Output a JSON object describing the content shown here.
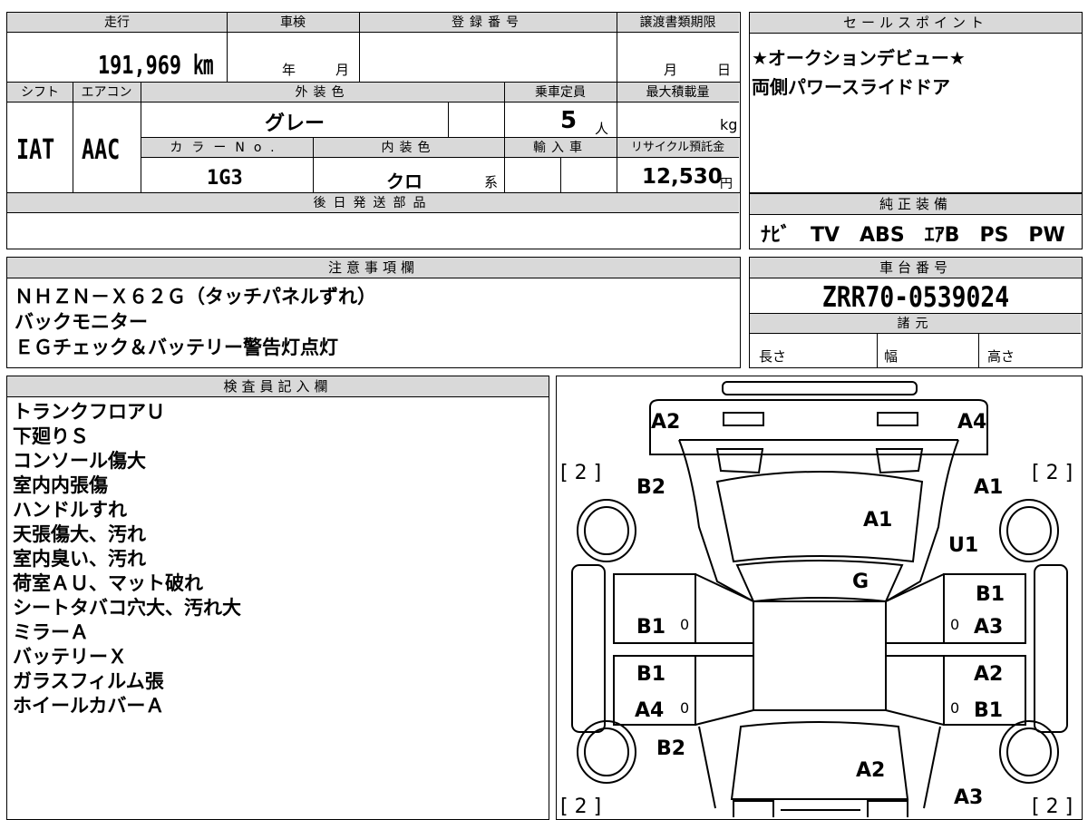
{
  "vehicle_info": {
    "mileage_label": "走行",
    "mileage_value": "191,969 ㎞",
    "inspection_label": "車検",
    "inspection_year": "年",
    "inspection_month": "月",
    "registration_label": "登録番号",
    "transfer_label": "譲渡書類期限",
    "transfer_month": "月",
    "transfer_day": "日",
    "shift_label": "シフト",
    "shift_value": "IAT",
    "ac_label": "エアコン",
    "ac_value": "AAC",
    "exterior_label": "外装色",
    "exterior_value": "グレー",
    "capacity_label": "乗車定員",
    "capacity_value": "5",
    "capacity_unit": "人",
    "load_label": "最大積載量",
    "load_unit": "kg",
    "color_no_label": "カラーNo.",
    "color_no_value": "1G3",
    "interior_label": "内装色",
    "interior_value": "クロ",
    "interior_suffix": "系",
    "import_label": "輸入車",
    "recycle_label": "リサイクル預託金",
    "recycle_value": "12,530",
    "recycle_unit": "円",
    "later_parts_label": "後日発送部品"
  },
  "sales_points": {
    "label": "セールスポイント",
    "lines": [
      "★オークションデビュー★",
      "両側パワースライドドア"
    ]
  },
  "equipment": {
    "label": "純正装備",
    "value": "ﾅﾋﾞ　TV　ABS　ｴｱB　PS　PW"
  },
  "notes": {
    "label": "注意事項欄",
    "lines": [
      "ＮＨＺＮ－Ｘ６２Ｇ（タッチパネルずれ）",
      "バックモニター",
      "ＥＧチェック＆バッテリー警告灯点灯"
    ]
  },
  "chassis": {
    "label": "車台番号",
    "value": "ZRR70-0539024",
    "spec_label": "諸元",
    "length_label": "長さ",
    "width_label": "幅",
    "height_label": "高さ"
  },
  "inspector": {
    "label": "検査員記入欄",
    "lines": [
      "トランクフロアＵ",
      "下廻りＳ",
      "コンソール傷大",
      "室内内張傷",
      "ハンドルすれ",
      "天張傷大、汚れ",
      "室内臭い、汚れ",
      "荷室ＡＵ、マット破れ",
      "シートタバコ穴大、汚れ大",
      "ミラーＡ",
      "バッテリーＸ",
      "ガラスフィルム張",
      "ホイールカバーＡ"
    ]
  },
  "diagram": {
    "marks": {
      "top_left": "A2",
      "top_right": "A4",
      "bracket_tl": "[ 2 ]",
      "bracket_tr": "[ 2 ]",
      "bracket_bl": "[ 2 ]",
      "bracket_br": "[ 2 ]",
      "front_left": "B2",
      "front_right": "A1",
      "front_right2": "U1",
      "windshield": "A1",
      "roof_front": "G",
      "left_front_door": "B1",
      "right_front_door_a": "B1",
      "right_front_door_b": "A3",
      "left_rear_door_a": "B1",
      "left_rear_door_b": "A4",
      "right_rear_door_a": "A2",
      "right_rear_door_b": "B1",
      "rear_left": "B2",
      "rear_center": "A2",
      "rear_right": "A3",
      "zero": "0"
    }
  }
}
